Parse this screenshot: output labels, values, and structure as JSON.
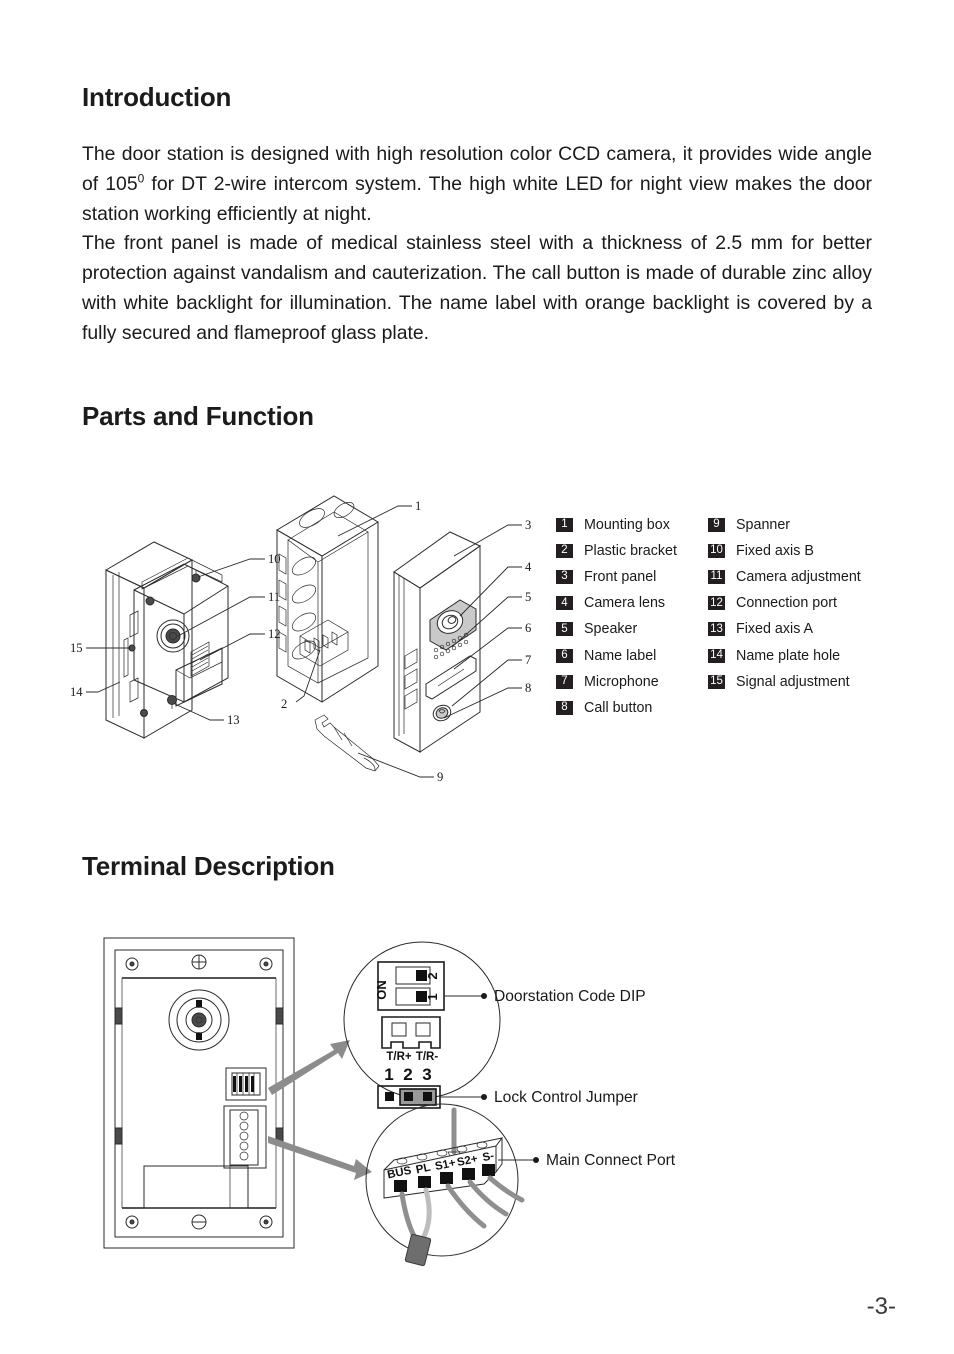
{
  "document": {
    "page_number": "-3-"
  },
  "sections": {
    "introduction": {
      "heading": "Introduction",
      "paragraph_1_part_1": "The door station is designed with high resolution color CCD camera, it provides wide angle of 105",
      "paragraph_1_degree": "0",
      "paragraph_1_part_2": " for DT 2-wire intercom system. The high white LED for night view makes the door station working efficiently at night.",
      "paragraph_2": "The front panel is made of medical stainless steel with a thickness of 2.5 mm for better protection against vandalism and cauterization. The call button is made of durable zinc alloy with white backlight for illumination. The name label with orange backlight is covered by a fully secured and flameproof glass plate."
    },
    "parts_and_function": {
      "heading": "Parts and Function",
      "legend_column_1": [
        {
          "number": "1",
          "label": "Mounting box"
        },
        {
          "number": "2",
          "label": "Plastic bracket"
        },
        {
          "number": "3",
          "label": "Front panel"
        },
        {
          "number": "4",
          "label": "Camera lens"
        },
        {
          "number": "5",
          "label": "Speaker"
        },
        {
          "number": "6",
          "label": "Name label"
        },
        {
          "number": "7",
          "label": "Microphone"
        },
        {
          "number": "8",
          "label": "Call button"
        }
      ],
      "legend_column_2": [
        {
          "number": "9",
          "label": "Spanner"
        },
        {
          "number": "10",
          "label": "Fixed axis B"
        },
        {
          "number": "11",
          "label": "Camera adjustment"
        },
        {
          "number": "12",
          "label": "Connection port"
        },
        {
          "number": "13",
          "label": "Fixed axis A"
        },
        {
          "number": "14",
          "label": "Name plate hole"
        },
        {
          "number": "15",
          "label": "Signal adjustment"
        }
      ],
      "diagram_callouts": {
        "left_view": [
          "10",
          "11",
          "12",
          "13",
          "14",
          "15"
        ],
        "center_view": [
          "1",
          "2"
        ],
        "right_view": [
          "3",
          "4",
          "5",
          "6",
          "7",
          "8"
        ],
        "tool": "9"
      }
    },
    "terminal_description": {
      "heading": "Terminal Description",
      "callouts": [
        {
          "id": "dip",
          "label": "Doorstation Code DIP"
        },
        {
          "id": "jumper",
          "label": "Lock Control Jumper"
        },
        {
          "id": "port",
          "label": "Main Connect Port"
        }
      ],
      "dip_switch": {
        "on_label": "ON",
        "switch_numbers": [
          "1",
          "2"
        ]
      },
      "tr_connector": {
        "labels": [
          "T/R+",
          "T/R-"
        ]
      },
      "jumper_pins": [
        "1",
        "2",
        "3"
      ],
      "connect_port_terminals": [
        "BUS",
        "PL",
        "S1+",
        "S2+",
        "S-"
      ]
    }
  },
  "colors": {
    "text": "#1a1a1a",
    "badge_background": "#231f20",
    "badge_text": "#ffffff",
    "line": "#2b2b2b",
    "arrow_gray": "#8c8c8c"
  }
}
